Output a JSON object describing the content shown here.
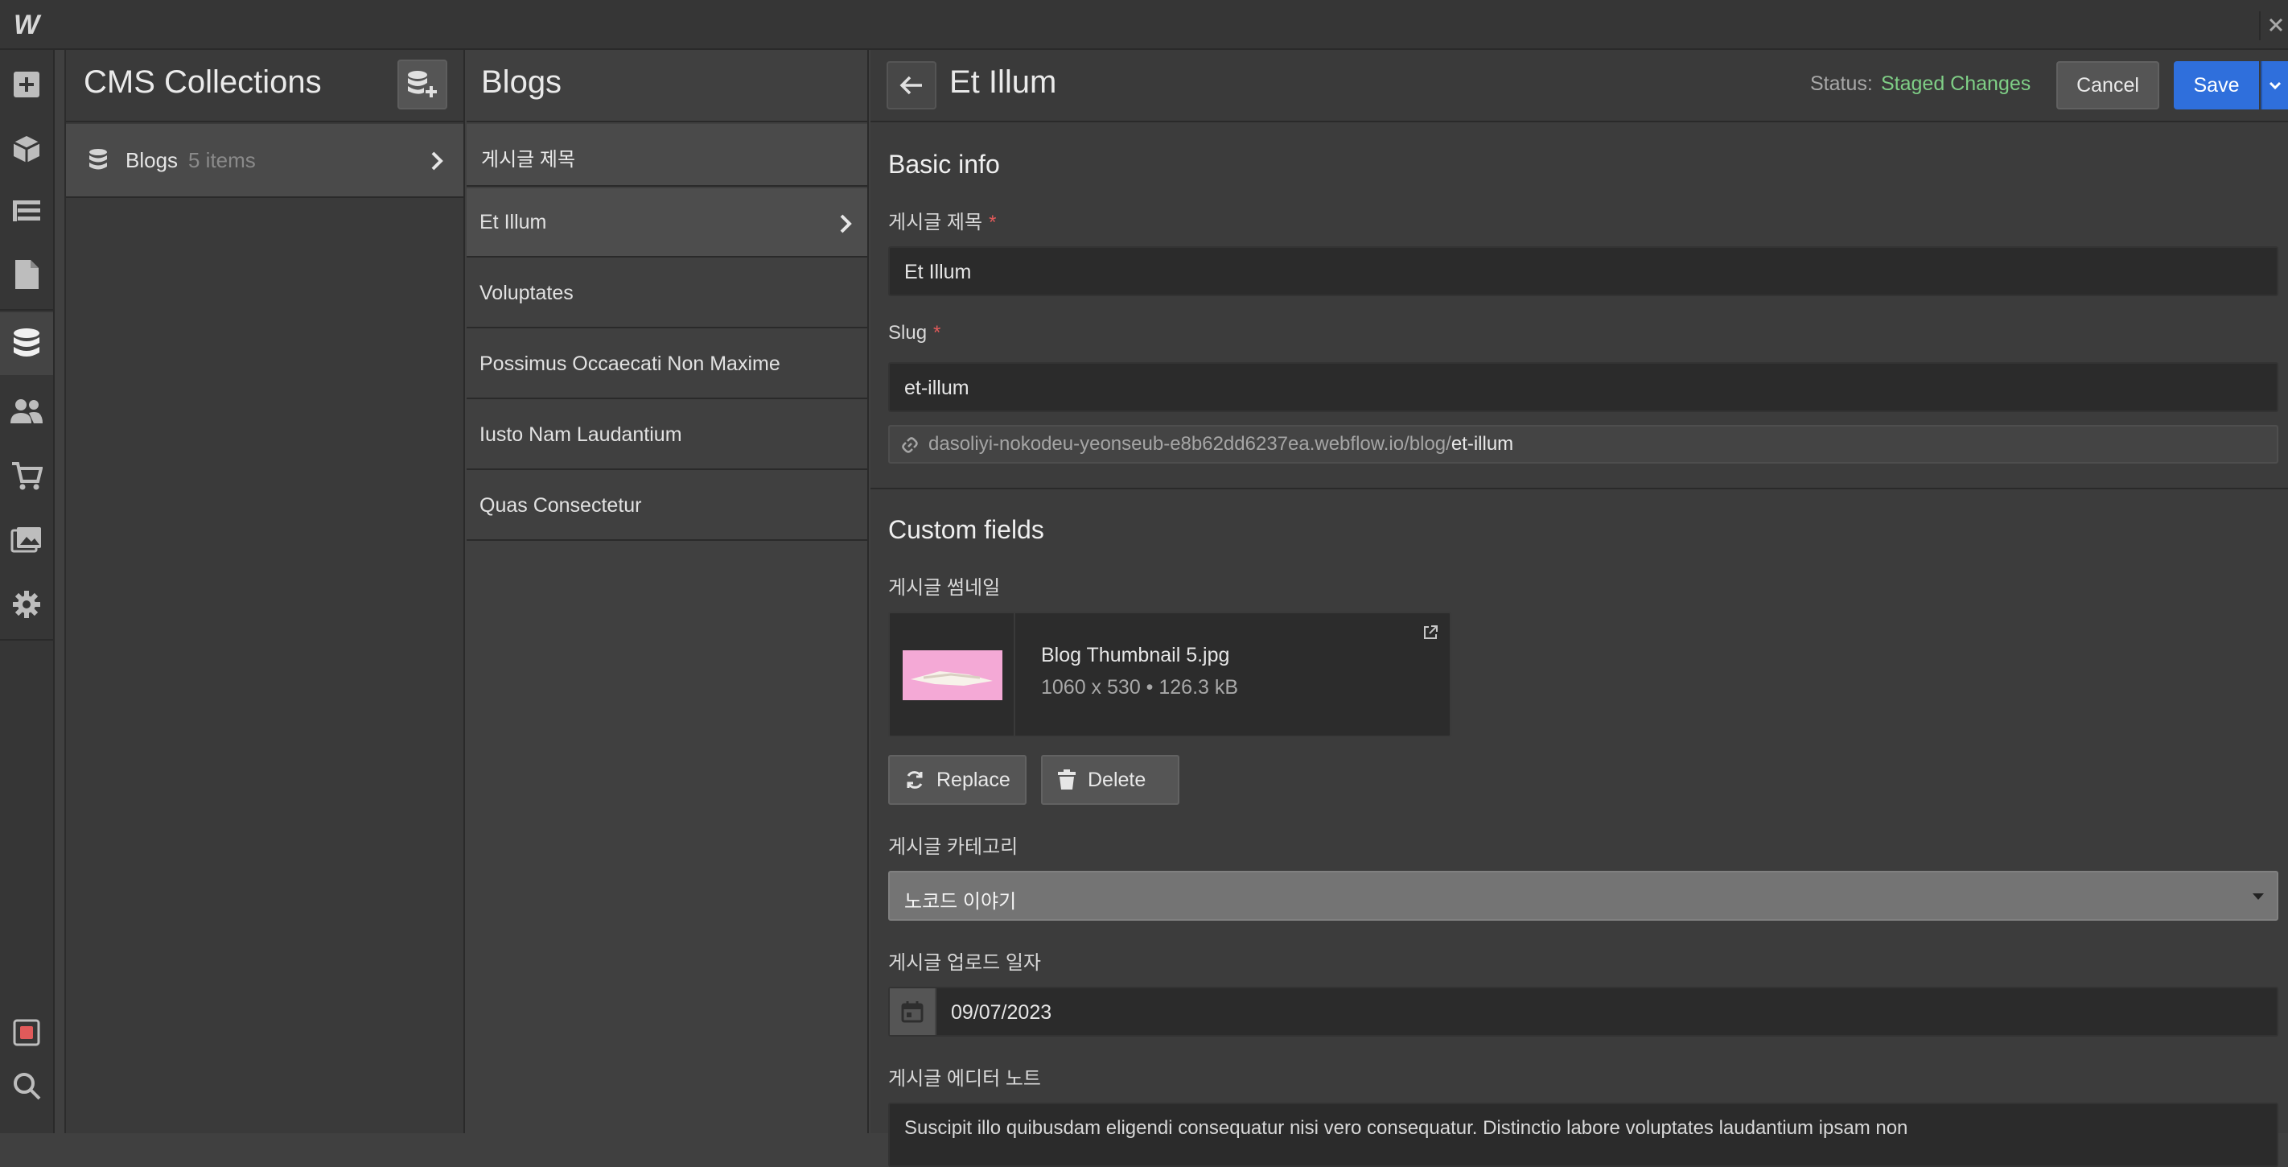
{
  "app": {
    "logo": "W"
  },
  "collections": {
    "title": "CMS Collections",
    "items": [
      {
        "name": "Blogs",
        "count": "5 items"
      }
    ]
  },
  "blogs": {
    "title": "Blogs",
    "column_header": "게시글 제목",
    "items": [
      "Et Illum",
      "Voluptates",
      "Possimus Occaecati Non Maxime",
      "Iusto Nam Laudantium",
      "Quas Consectetur"
    ]
  },
  "editor": {
    "title": "Et Illum",
    "status_label": "Status:",
    "status_value": "Staged Changes",
    "cancel_label": "Cancel",
    "save_label": "Save",
    "basic_info_title": "Basic info",
    "name_label": "게시글 제목",
    "name_value": "Et Illum",
    "slug_label": "Slug",
    "slug_value": "et-illum",
    "url_base": "dasoliyi-nokodeu-yeonseub-e8b62dd6237ea.webflow.io/blog/",
    "url_slug": "et-illum",
    "custom_fields_title": "Custom fields",
    "thumbnail_label": "게시글 썸네일",
    "thumbnail_name": "Blog Thumbnail 5.jpg",
    "thumbnail_meta": "1060 x 530 • 126.3 kB",
    "replace_label": "Replace",
    "delete_label": "Delete",
    "category_label": "게시글 카테고리",
    "category_value": "노코드 이야기",
    "date_label": "게시글 업로드 일자",
    "date_value": "09/07/2023",
    "notes_label": "게시글 에디터 노트",
    "notes_value": "Suscipit illo quibusdam eligendi consequatur nisi vero consequatur. Distinctio labore voluptates laudantium ipsam non"
  },
  "colors": {
    "accent": "#2f6fdc",
    "status": "#7fcf86",
    "required": "#e15a5a"
  },
  "icons": [
    "add-icon",
    "cube-icon",
    "navigator-icon",
    "pages-icon",
    "database-icon",
    "users-icon",
    "cart-icon",
    "assets-icon",
    "gear-icon",
    "record-icon",
    "search-icon"
  ]
}
